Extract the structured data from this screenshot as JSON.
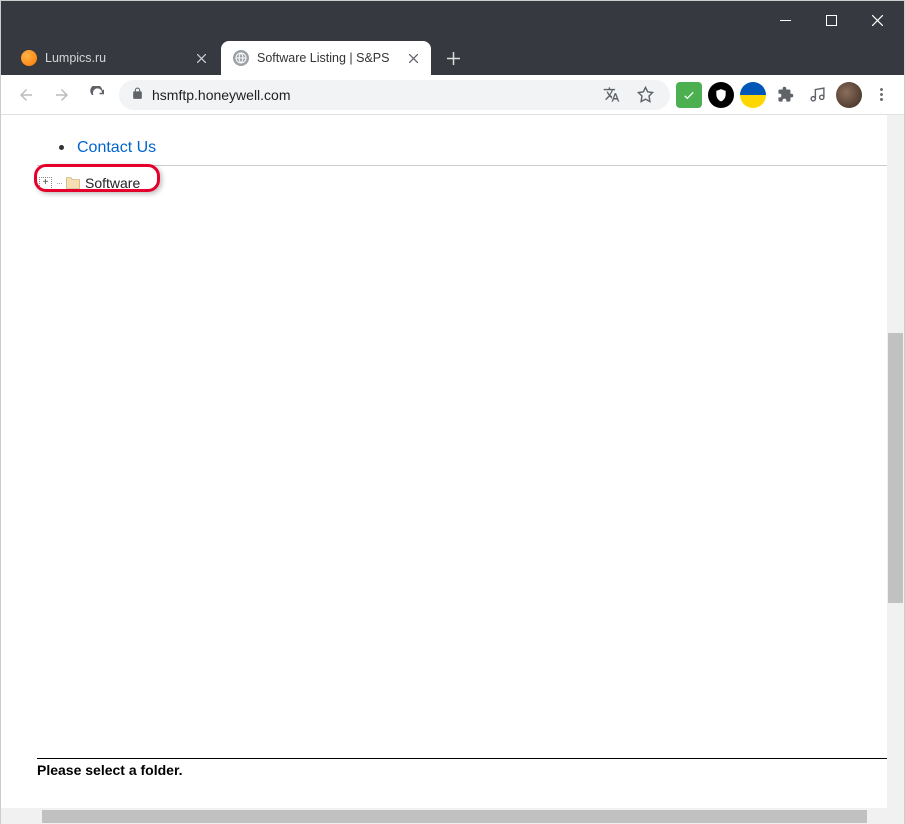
{
  "window": {
    "minimize": "",
    "maximize": "",
    "close": ""
  },
  "tabs": [
    {
      "label": "Lumpics.ru",
      "active": false,
      "favicon": "orange"
    },
    {
      "label": "Software Listing | S&PS",
      "active": true,
      "favicon": "globe"
    }
  ],
  "address": {
    "url": "hsmftp.honeywell.com"
  },
  "nav": {
    "link_text": "Contact Us"
  },
  "tree": {
    "root_label": "Software"
  },
  "status": {
    "message": "Please select a folder."
  },
  "toolbar_icons": {
    "translate": "translate-icon",
    "star": "star-icon",
    "check": "check-icon",
    "shield": "shield-icon",
    "flag": "flag-icon",
    "puzzle": "puzzle-icon",
    "music": "music-icon",
    "avatar": "avatar",
    "menu": "menu-icon"
  }
}
